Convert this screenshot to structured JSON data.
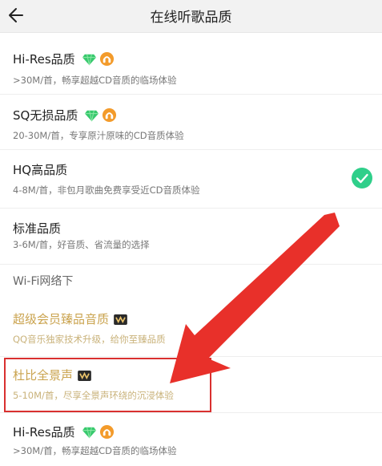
{
  "header": {
    "title": "在线听歌品质"
  },
  "items": [
    {
      "name": "Hi-Res品质",
      "desc": ">30M/首，畅享超越CD音质的临场体验"
    },
    {
      "name": "SQ无损品质",
      "desc": "20-30M/首，专享原汁原味的CD音质体验"
    },
    {
      "name": "HQ高品质",
      "desc": "4-8M/首，非包月歌曲免费享受近CD音质体验"
    },
    {
      "name": "标准品质",
      "desc": "3-6M/首，好音质、省流量的选择"
    }
  ],
  "wifi": {
    "label": "Wi-Fi网络下"
  },
  "super": {
    "name": "超级会员臻品音质",
    "desc": "QQ音乐独家技术升级，给你至臻品质"
  },
  "dolby": {
    "name": "杜比全景声",
    "desc": "5-10M/首，尽享全景声环绕的沉浸体验"
  },
  "last": {
    "name": "Hi-Res品质",
    "desc": ">30M/首，畅享超越CD音质的临场体验"
  },
  "colors": {
    "accent_green": "#2fcf8a",
    "gold": "#caa34e",
    "highlight_red": "#d9302f"
  }
}
